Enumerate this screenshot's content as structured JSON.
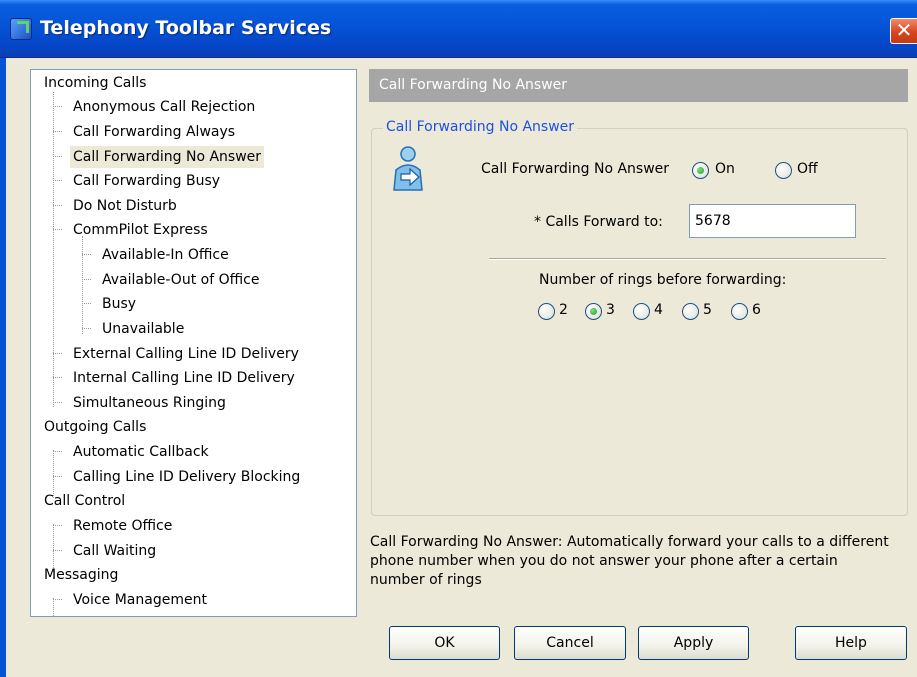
{
  "window": {
    "title": "Telephony Toolbar Services",
    "close_label": "✕"
  },
  "tree": {
    "incoming": {
      "label": "Incoming Calls",
      "items": [
        "Anonymous Call Rejection",
        "Call Forwarding Always",
        "Call Forwarding No Answer",
        "Call Forwarding Busy",
        "Do Not Disturb",
        "CommPilot Express"
      ],
      "commpilot_children": [
        "Available-In Office",
        "Available-Out of Office",
        "Busy",
        "Unavailable"
      ],
      "items_after": [
        "External Calling Line ID Delivery",
        "Internal Calling Line ID Delivery",
        "Simultaneous Ringing"
      ]
    },
    "outgoing": {
      "label": "Outgoing Calls",
      "items": [
        "Automatic Callback",
        "Calling Line ID Delivery Blocking"
      ]
    },
    "control": {
      "label": "Call Control",
      "items": [
        "Remote Office",
        "Call Waiting"
      ]
    },
    "messaging": {
      "label": "Messaging",
      "items": [
        "Voice Management"
      ]
    },
    "selected": "Call Forwarding No Answer"
  },
  "panel": {
    "header": "Call Forwarding No Answer",
    "group_title": "Call Forwarding No Answer",
    "toggle_label": "Call Forwarding No Answer",
    "on_label": "On",
    "off_label": "Off",
    "toggle_value": "On",
    "forward_label": "* Calls Forward to:",
    "forward_value": "5678",
    "rings_label": "Number of rings before forwarding:",
    "ring_options": [
      "2",
      "3",
      "4",
      "5",
      "6"
    ],
    "ring_selected": "3",
    "description": "Call Forwarding No Answer: Automatically forward your calls to a different phone number when you do not answer your phone after a certain number of rings"
  },
  "buttons": {
    "ok": "OK",
    "cancel": "Cancel",
    "apply": "Apply",
    "help": "Help"
  },
  "colors": {
    "titlebar": "#0553d6",
    "group_title": "#1e50e0",
    "header_bg": "#a6a6a6",
    "dialog_bg": "#ece9d8"
  }
}
